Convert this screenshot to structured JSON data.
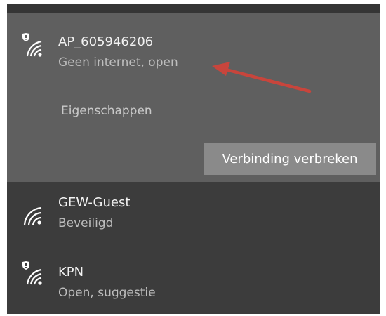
{
  "networks": [
    {
      "name": "AP_605946206",
      "status": "Geen internet, open",
      "properties_link": "Eigenschappen",
      "disconnect_label": "Verbinding verbreken",
      "icon": "wifi-open-shield-icon",
      "selected": true
    },
    {
      "name": "GEW-Guest",
      "status": "Beveiligd",
      "icon": "wifi-icon",
      "selected": false
    },
    {
      "name": "KPN",
      "status": "Open, suggestie",
      "icon": "wifi-open-shield-icon",
      "selected": false
    }
  ],
  "annotation": {
    "type": "red-arrow",
    "color": "#c8453c",
    "points_to": "network-status"
  },
  "colors": {
    "panel_bg": "#3c3c3c",
    "selected_bg": "#5f5f5f",
    "button_bg": "#8a8a8a",
    "text_primary": "#f2f2f2",
    "text_secondary": "#bdbdbd"
  }
}
